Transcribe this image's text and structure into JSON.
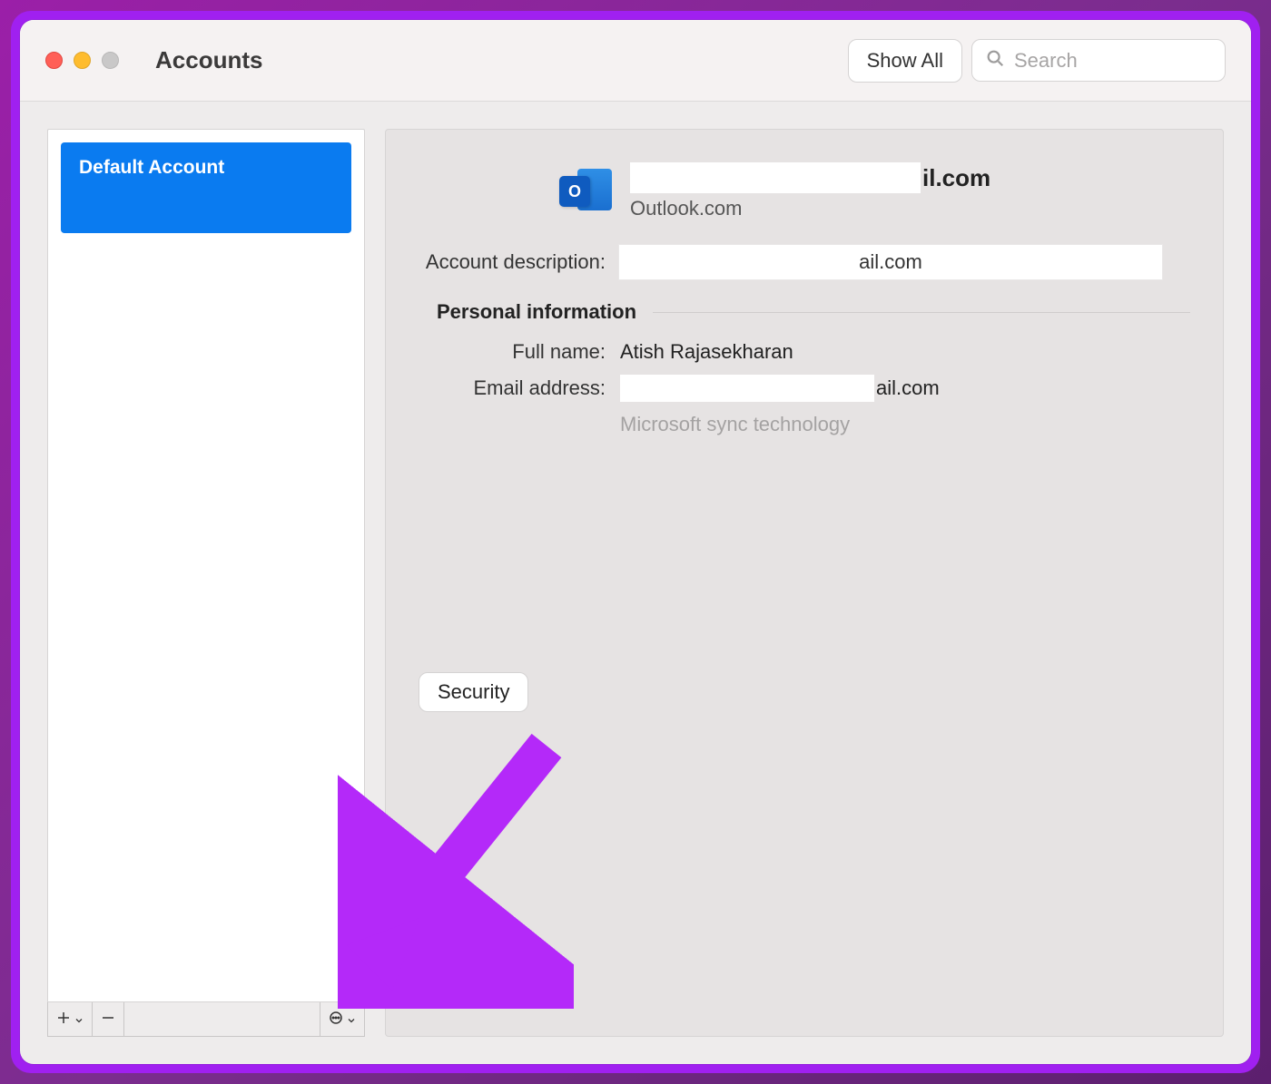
{
  "window": {
    "title": "Accounts",
    "show_all_label": "Show All",
    "search_placeholder": "Search"
  },
  "sidebar": {
    "accounts": [
      {
        "label": "Default Account"
      }
    ],
    "toolbar": {
      "add_label": "+",
      "remove_label": "−",
      "more_label": "⋯"
    }
  },
  "detail": {
    "header": {
      "email_suffix": "il.com",
      "account_type": "Outlook.com",
      "icon_letter": "O"
    },
    "fields": {
      "account_description_label": "Account description:",
      "account_description_value": "ail.com",
      "section_title": "Personal information",
      "full_name_label": "Full name:",
      "full_name_value": "Atish Rajasekharan",
      "email_label": "Email address:",
      "email_suffix": "ail.com",
      "sync_note": "Microsoft sync technology"
    },
    "security_label": "Security"
  },
  "annotation": {
    "arrow_color": "#b429f9"
  }
}
